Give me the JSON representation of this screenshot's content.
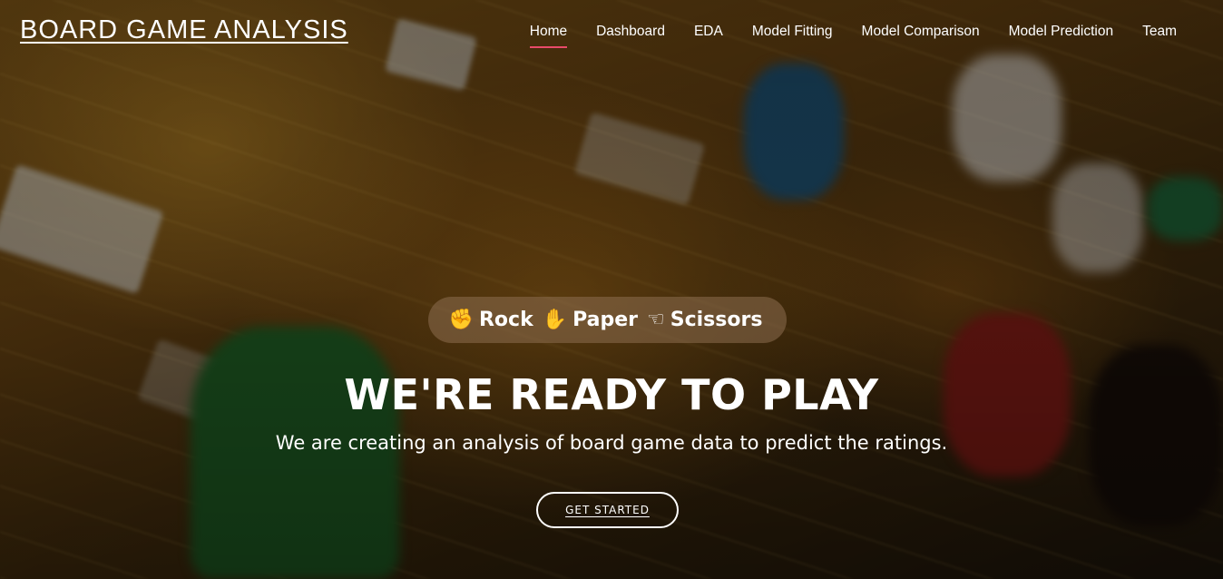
{
  "header": {
    "brand": "BOARD GAME ANALYSIS",
    "nav": [
      {
        "label": "Home",
        "active": true
      },
      {
        "label": "Dashboard",
        "active": false
      },
      {
        "label": "EDA",
        "active": false
      },
      {
        "label": "Model Fitting",
        "active": false
      },
      {
        "label": "Model Comparison",
        "active": false
      },
      {
        "label": "Model Prediction",
        "active": false
      },
      {
        "label": "Team",
        "active": false
      }
    ]
  },
  "hero": {
    "badge": {
      "items": [
        {
          "icon": "fist-icon",
          "glyph": "✊",
          "label": "Rock"
        },
        {
          "icon": "raised-hand-icon",
          "glyph": "✋",
          "label": "Paper"
        },
        {
          "icon": "pointing-hand-icon",
          "glyph": "☜",
          "label": "Scissors"
        }
      ]
    },
    "title": "WE'RE READY TO PLAY",
    "subtitle": "We are creating an analysis of board game data to predict the ratings.",
    "cta_label": "GET STARTED"
  },
  "colors": {
    "accent": "#e84a6a",
    "text": "#ffffff"
  }
}
